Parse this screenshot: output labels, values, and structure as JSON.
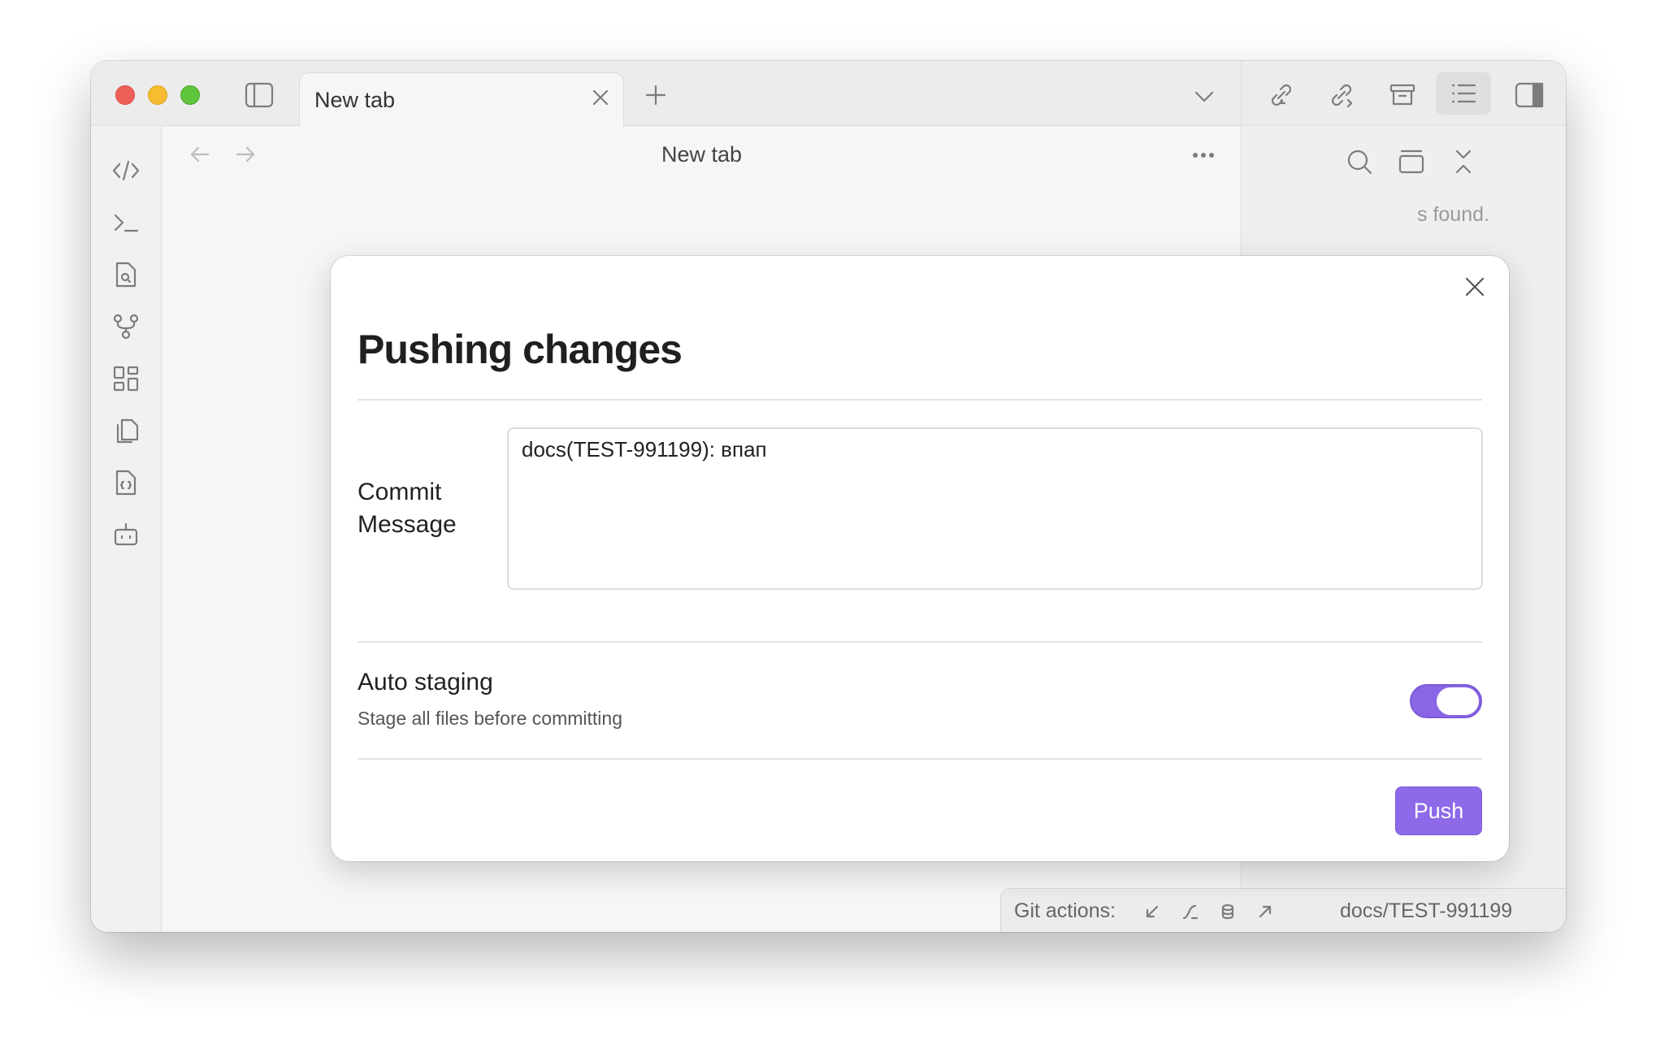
{
  "window": {
    "tab": {
      "title": "New tab"
    },
    "nav_title": "New tab"
  },
  "ribbon": {
    "items": [
      "code-icon",
      "terminal-icon",
      "file-search-icon",
      "git-graph-icon",
      "dashboard-icon",
      "copy-icon",
      "file-code-icon",
      "bot-icon"
    ]
  },
  "right_pane": {
    "empty_text": "s found."
  },
  "status": {
    "git_actions_label": "Git actions:",
    "branch": "docs/TEST-991199"
  },
  "modal": {
    "title": "Pushing changes",
    "commit_label": "Commit Message",
    "commit_value": "docs(TEST-991199): впап",
    "auto_staging_title": "Auto staging",
    "auto_staging_desc": "Stage all files before committing",
    "auto_staging_on": true,
    "push_label": "Push"
  },
  "colors": {
    "accent": "#8e6ae8",
    "close_red": "#ee5f57",
    "minimize_yellow": "#f5bd2f",
    "zoom_green": "#5fc53c"
  }
}
